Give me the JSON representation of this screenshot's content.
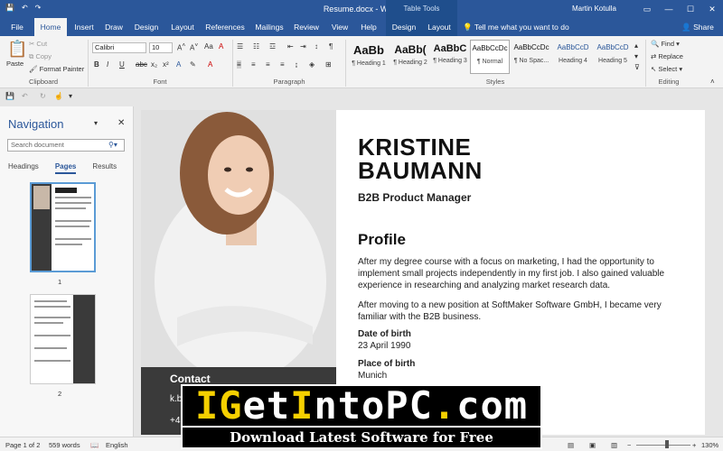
{
  "window": {
    "doc_title": "Resume.docx - Word",
    "context_tools": "Table Tools",
    "user": "Martin Kotulla"
  },
  "tabs": [
    "File",
    "Home",
    "Insert",
    "Draw",
    "Design",
    "Layout",
    "References",
    "Mailings",
    "Review",
    "View",
    "Help",
    "Design",
    "Layout"
  ],
  "tell_me": "Tell me what you want to do",
  "share": "Share",
  "ribbon": {
    "clipboard": {
      "paste": "Paste",
      "cut": "Cut",
      "copy": "Copy",
      "format_painter": "Format Painter",
      "label": "Clipboard"
    },
    "font": {
      "name": "Calibri",
      "size": "10",
      "label": "Font"
    },
    "paragraph": {
      "label": "Paragraph"
    },
    "styles": {
      "label": "Styles",
      "items": [
        {
          "sample": "AaBb",
          "name": "¶ Heading 1"
        },
        {
          "sample": "AaBb(",
          "name": "¶ Heading 2"
        },
        {
          "sample": "AaBbC",
          "name": "¶ Heading 3"
        },
        {
          "sample": "AaBbCcDc",
          "name": "¶ Normal"
        },
        {
          "sample": "AaBbCcDc",
          "name": "¶ No Spac..."
        },
        {
          "sample": "AaBbCcD",
          "name": "Heading 4"
        },
        {
          "sample": "AaBbCcD",
          "name": "Heading 5"
        }
      ]
    },
    "editing": {
      "find": "Find",
      "replace": "Replace",
      "select": "Select",
      "label": "Editing"
    }
  },
  "nav": {
    "title": "Navigation",
    "search_placeholder": "Search document",
    "tabs": [
      "Headings",
      "Pages",
      "Results"
    ],
    "page_numbers": [
      "1",
      "2"
    ]
  },
  "doc": {
    "name_line1": "KRISTINE",
    "name_line2": "BAUMANN",
    "role": "B2B Product Manager",
    "profile_title": "Profile",
    "para1": "After my degree course with a focus on marketing, I had the opportunity to implement small projects independently in my first job. I also gained valuable experience in researching and analyzing market research data.",
    "para2": "After moving to a new position at SoftMaker Software GmbH, I became very familiar with the B2B business.",
    "dob_label": "Date of birth",
    "dob_value": "23 April 1990",
    "pob_label": "Place of birth",
    "pob_value": "Munich",
    "contact_title": "Contact",
    "contact_email": "k.b",
    "contact_phone": "+4"
  },
  "status": {
    "page": "Page 1 of 2",
    "words": "559 words",
    "language": "English",
    "zoom": "130%"
  },
  "watermark": {
    "line1_a": "I",
    "line1_b": "G",
    "line1_c": "et",
    "line1_d": "I",
    "line1_e": "nto",
    "line1_f": "PC",
    "line1_g": ".",
    "line1_h": "com",
    "line2": "Download Latest Software for Free"
  }
}
